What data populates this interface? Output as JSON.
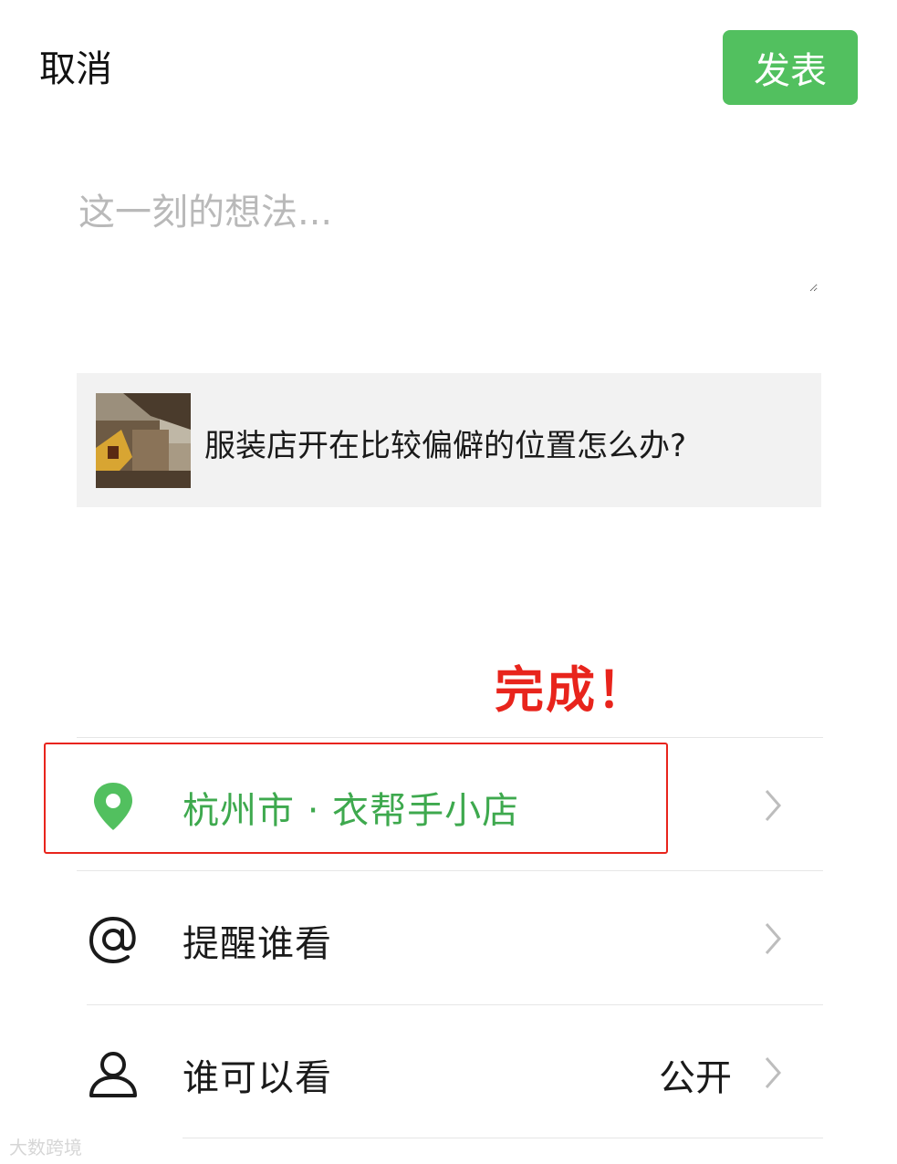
{
  "header": {
    "cancel_label": "取消",
    "publish_label": "发表",
    "publish_color": "#52c05f"
  },
  "composer": {
    "placeholder": "这一刻的想法..."
  },
  "link_card": {
    "title": "服装店开在比较偏僻的位置怎么办?"
  },
  "annotation": {
    "text": "完成！",
    "color": "#e8241c"
  },
  "options": {
    "location": {
      "label": "杭州市 · 衣帮手小店",
      "icon": "location-pin-icon",
      "color": "#3ea94e"
    },
    "mention": {
      "label": "提醒谁看",
      "icon": "at-sign-icon"
    },
    "visibility": {
      "label": "谁可以看",
      "value": "公开",
      "icon": "person-icon"
    }
  },
  "watermark": {
    "text": "大数跨境"
  }
}
